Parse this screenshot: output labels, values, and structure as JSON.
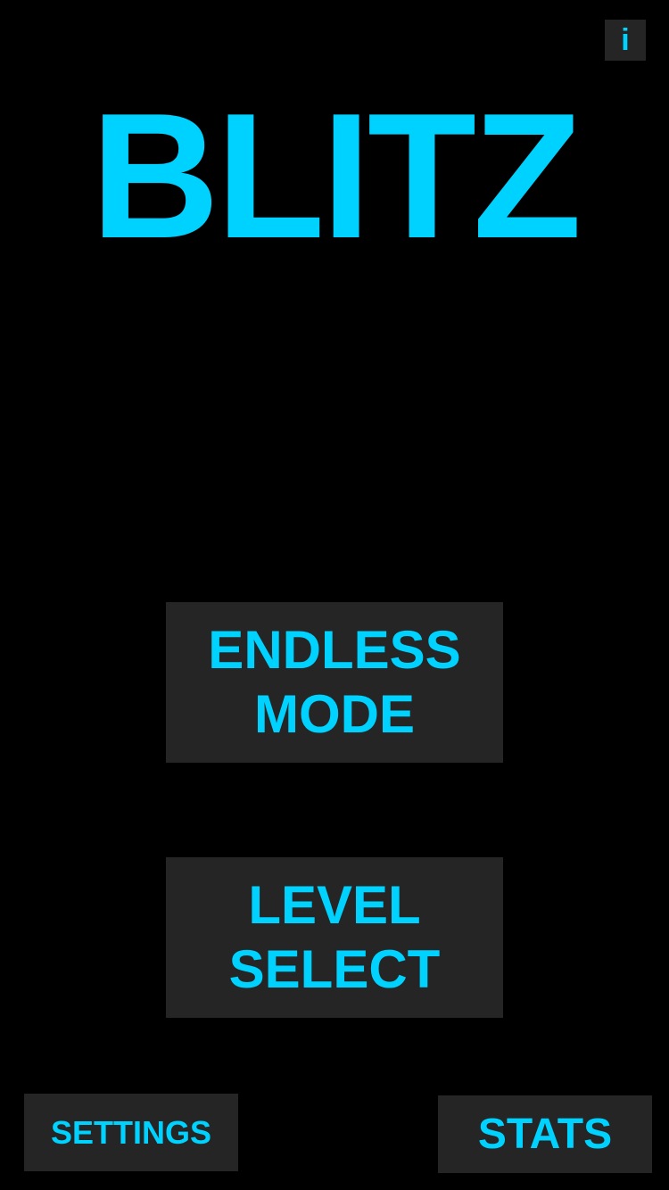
{
  "info_button": {
    "label": "i"
  },
  "title": "BLITZ",
  "menu": {
    "endless": {
      "line1": "ENDLESS",
      "line2": "MODE"
    },
    "level_select": {
      "line1": "LEVEL",
      "line2": "SELECT"
    }
  },
  "footer": {
    "settings_label": "SETTINGS",
    "stats_label": "STATS"
  },
  "colors": {
    "background": "#000000",
    "accent": "#00d2ff",
    "button": "#252525"
  }
}
